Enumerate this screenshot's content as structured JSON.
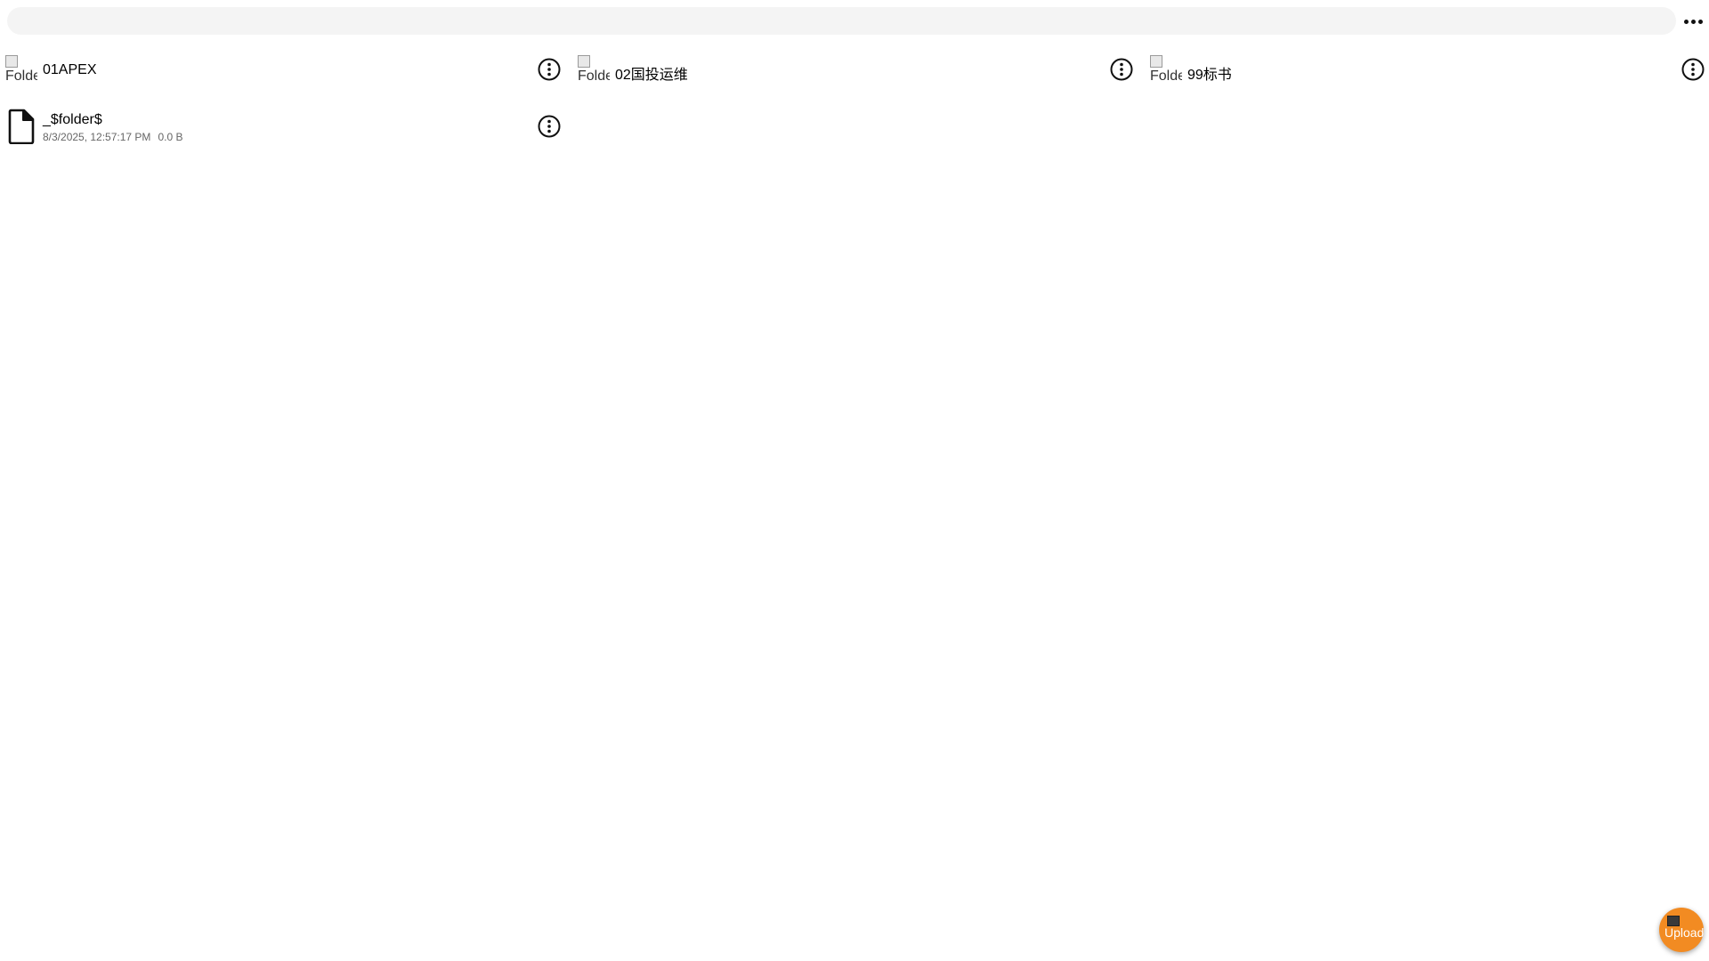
{
  "toolbar": {
    "path_value": "",
    "more_icon": "more-horizontal-icon"
  },
  "folders": [
    {
      "name": "01APEX",
      "thumb_alt": "Folder",
      "menu_icon": "more-vertical-circle-icon"
    },
    {
      "name": "02国投运维",
      "thumb_alt": "Folder",
      "menu_icon": "more-vertical-circle-icon"
    },
    {
      "name": "99标书",
      "thumb_alt": "Folder",
      "menu_icon": "more-vertical-circle-icon"
    }
  ],
  "files": [
    {
      "name": "_$folder$",
      "date": "8/3/2025, 12:57:17 PM",
      "size": "0.0 B",
      "icon": "file-icon",
      "menu_icon": "more-vertical-circle-icon"
    }
  ],
  "upload_button": {
    "alt": "Upload",
    "accent_color": "#f28b22"
  }
}
